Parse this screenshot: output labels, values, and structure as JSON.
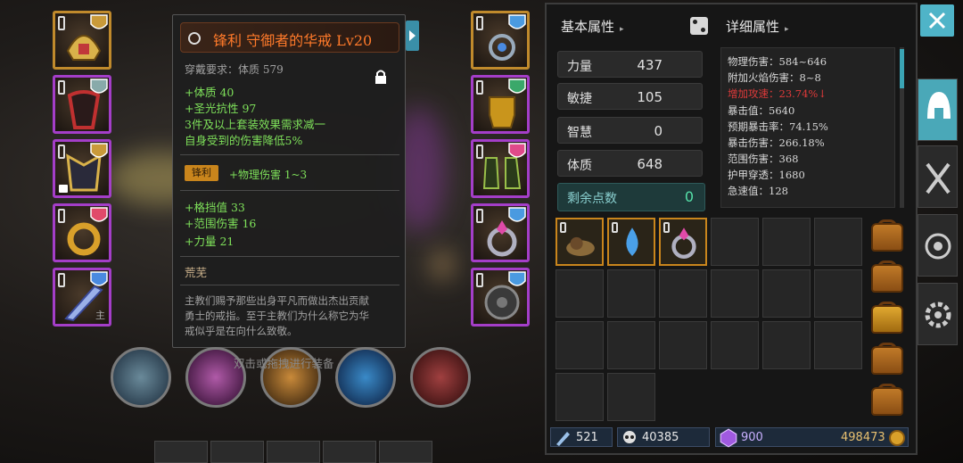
{
  "tooltip": {
    "title": "锋利 守御者的华戒 Lv20",
    "requirement": "穿戴要求：体质 579",
    "lines": [
      "+体质 40",
      "+圣光抗性 97",
      "3件及以上套装效果需求减一",
      "自身受到的伤害降低5%"
    ],
    "badge": "锋利",
    "badge_effect": "+物理伤害 1~3",
    "bonus": [
      "+格挡值 33",
      "+范围伤害 16",
      "+力量 21"
    ],
    "origin": "荒芜",
    "desc": [
      "主教们赐予那些出身平凡而做出杰出贡献",
      "勇士的戒指。至于主教们为什么称它为华",
      "戒似乎是在向什么致敬。"
    ]
  },
  "hint": "双击或拖拽进行装备",
  "left_slot_sub": "主",
  "basic": {
    "header": "基本属性",
    "attrs": [
      {
        "name": "力量",
        "value": "437"
      },
      {
        "name": "敏捷",
        "value": "105"
      },
      {
        "name": "智慧",
        "value": "0"
      },
      {
        "name": "体质",
        "value": "648"
      }
    ],
    "remaining": {
      "name": "剩余点数",
      "value": "0"
    }
  },
  "detail": {
    "header": "详细属性",
    "lines": [
      "物理伤害：584~646",
      "附加火焰伤害：8~8",
      "增加攻速：23.74%↓",
      "暴击值：5640",
      "预期暴击率：74.15%",
      "暴击伤害：266.18%",
      "范围伤害：368",
      "护甲穿透：1680",
      "急速值：128"
    ]
  },
  "currency": {
    "a": "521",
    "b": "40385",
    "c": "900",
    "d": "498473"
  },
  "colors": {
    "purple": "#a43ec8",
    "gold": "#c08a2c",
    "accent": "#4fb4c8",
    "title": "#ff7a2a",
    "green": "#7ee05a",
    "red": "#e03a3a"
  },
  "icons": {
    "close": "close-icon",
    "helmet": "helmet-icon",
    "weapons": "crossed-swords-icon",
    "target": "target-icon",
    "gear": "gear-icon"
  }
}
